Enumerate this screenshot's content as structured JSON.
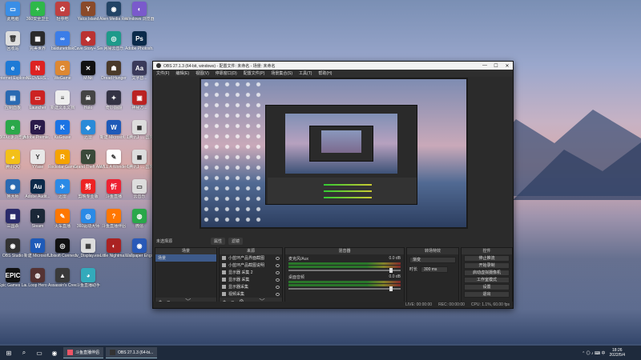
{
  "desktop": {
    "icons": [
      {
        "label": "此电脑",
        "color": "#3a8ee6",
        "glyph": "▭"
      },
      {
        "label": "360安全卫士",
        "color": "#2eb84a",
        "glyph": "+"
      },
      {
        "label": "轻亭吧",
        "color": "#c04040",
        "glyph": "✿"
      },
      {
        "label": "Yalcs Island",
        "color": "#8a4a2a",
        "glyph": "Y"
      },
      {
        "label": "Alien Media Recorder 4",
        "color": "#224466",
        "glyph": "◉"
      },
      {
        "label": "Windows 浏览器",
        "color": "#7a5acc",
        "glyph": "◐"
      },
      {
        "label": "回收站",
        "color": "#dddddd",
        "glyph": "🗑"
      },
      {
        "label": "完美世界",
        "color": "#2a2a2a",
        "glyph": "▦"
      },
      {
        "label": "baidunetdisk",
        "color": "#3b7de8",
        "glyph": "∞"
      },
      {
        "label": "Cave Story+ Secret Santa",
        "color": "#b33",
        "glyph": "◆"
      },
      {
        "label": "网易云音乐",
        "color": "#1e9a8a",
        "glyph": "◎"
      },
      {
        "label": "Adobe Photosh...",
        "color": "#0b2a4a",
        "glyph": "Ps"
      },
      {
        "label": "Internet Explorer",
        "color": "#1e7ad6",
        "glyph": "e"
      },
      {
        "label": "NEOVERS...",
        "color": "#d22",
        "glyph": "N"
      },
      {
        "label": "WeGame",
        "color": "#d83",
        "glyph": "G"
      },
      {
        "label": "MiNit",
        "color": "#111",
        "glyph": "✕"
      },
      {
        "label": "Dread Hunger",
        "color": "#4a3a2a",
        "glyph": "☗"
      },
      {
        "label": "文字替...",
        "color": "#3a3a5a",
        "glyph": "Aa"
      },
      {
        "label": "控制面板",
        "color": "#2a6ab2",
        "glyph": "▤"
      },
      {
        "label": "Launcher",
        "color": "#c22",
        "glyph": "▭"
      },
      {
        "label": "新建文本文档",
        "color": "#eee",
        "glyph": "≡"
      },
      {
        "label": "Holo",
        "color": "#444",
        "glyph": "☠"
      },
      {
        "label": "奇妙翻翻",
        "color": "#334",
        "glyph": "✦"
      },
      {
        "label": "神秘方...",
        "color": "#b22",
        "glyph": "▣"
      },
      {
        "label": "360极速浏览器",
        "color": "#2ba84a",
        "glyph": "e"
      },
      {
        "label": "Adobe Premie...",
        "color": "#2a1a4a",
        "glyph": "Pr"
      },
      {
        "label": "KuGouse",
        "color": "#1b74e4",
        "glyph": "K"
      },
      {
        "label": "迅雷",
        "color": "#2a8ad8",
        "glyph": "◆"
      },
      {
        "label": "新建 Microsof...",
        "color": "#1e5ab8",
        "glyph": "W"
      },
      {
        "label": "【腾讯】... 国外域名",
        "color": "#ddd",
        "glyph": "◼"
      },
      {
        "label": "腾讯QQ",
        "color": "#f3c018",
        "glyph": "◕"
      },
      {
        "label": "YYase",
        "color": "#e8e8e8",
        "glyph": "Y"
      },
      {
        "label": "Rockstar Games...",
        "color": "#f5a300",
        "glyph": "R"
      },
      {
        "label": "Grand Theft Auto V",
        "color": "#3a4a3a",
        "glyph": "V"
      },
      {
        "label": "WILL A Wonderf...",
        "color": "#fff",
        "glyph": "✎"
      },
      {
        "label": "【腾讯】... 国外域名",
        "color": "#ddd",
        "glyph": "◼"
      },
      {
        "label": "鲁大师",
        "color": "#2a6ab2",
        "glyph": "◉"
      },
      {
        "label": "Adobe Audit...",
        "color": "#0b2a4a",
        "glyph": "Au"
      },
      {
        "label": "迅雷",
        "color": "#2a8ae6",
        "glyph": "✈"
      },
      {
        "label": "剪映专业版",
        "color": "#e22",
        "glyph": "剪"
      },
      {
        "label": "斗鱼直播",
        "color": "#e23",
        "glyph": "忻"
      },
      {
        "label": "云音乐",
        "color": "#ddd",
        "glyph": "▭"
      },
      {
        "label": "三国杀",
        "color": "#2a2a6a",
        "glyph": "▩"
      },
      {
        "label": "Steam",
        "color": "#1b2838",
        "glyph": "◑"
      },
      {
        "label": "火车直播",
        "color": "#f70",
        "glyph": "✎"
      },
      {
        "label": "360驱动大师",
        "color": "#2a8ae6",
        "glyph": "◎"
      },
      {
        "label": "斗鱼直播伴侣",
        "color": "#f70",
        "glyph": "?"
      },
      {
        "label": "微信",
        "color": "#2aa84a",
        "glyph": "◍"
      },
      {
        "label": "OBS Studio",
        "color": "#333",
        "glyph": "◉"
      },
      {
        "label": "新建 Microsof...",
        "color": "#1e5ab8",
        "glyph": "W"
      },
      {
        "label": "Ubisoft Connect",
        "color": "#111",
        "glyph": "◎"
      },
      {
        "label": "Iv_Display.exe",
        "color": "#ddd",
        "glyph": "▦"
      },
      {
        "label": "Little Nightma...",
        "color": "#a22",
        "glyph": "◐"
      },
      {
        "label": "Wallpaper Engine...",
        "color": "#2a5ab8",
        "glyph": "◉"
      },
      {
        "label": "Epic Games Launcher",
        "color": "#111",
        "glyph": "EPIC"
      },
      {
        "label": "Loop Hero",
        "color": "#533",
        "glyph": "◍"
      },
      {
        "label": "Assassin's Creed O...",
        "color": "#3a3a3a",
        "glyph": "▲"
      },
      {
        "label": "斗鱼直播助手",
        "color": "#3ab",
        "glyph": "◕"
      }
    ]
  },
  "obs": {
    "title": "OBS 27.1.3 (64-bit, windows) - 配置文件: 未命名 - 场景: 未命名",
    "menu": [
      "文件(F)",
      "编辑(E)",
      "视图(V)",
      "停靠窗口(D)",
      "配置文件(P)",
      "场景集合(S)",
      "工具(T)",
      "帮助(H)"
    ],
    "no_source_label": "未选择源",
    "props_label": "属性",
    "filters_label": "滤镜",
    "docks": {
      "scenes": {
        "title": "场景",
        "items": [
          "场景"
        ]
      },
      "sources": {
        "title": "来源",
        "items": [
          "小蓝环产品界面截图",
          "小蓝环产品截图说明",
          "显示器 采集 2",
          "显示器 采集",
          "显示器采集",
          "视频采集",
          "图像"
        ]
      },
      "mixer": {
        "title": "混音器",
        "items": [
          {
            "name": "麦克风/Aux",
            "db": "0.0 dB"
          },
          {
            "name": "桌面音频",
            "db": "0.0 dB"
          }
        ]
      },
      "transitions": {
        "title": "转场特效",
        "type": "渐变",
        "duration_label": "时长",
        "duration": "300 ms"
      },
      "controls": {
        "title": "控件",
        "buttons": [
          "停止推流",
          "开始录制",
          "启动虚拟摄像机",
          "工作室模式",
          "设置",
          "退出"
        ]
      }
    },
    "status": {
      "live": "LIVE: 00:00:00",
      "rec": "REC: 00:00:00",
      "cpu": "CPU: 1.1%, 60.00 fps"
    }
  },
  "taskbar": {
    "apps": [
      {
        "label": "斗鱼直播伴侣",
        "color": "#e56"
      },
      {
        "label": "OBS 27.1.3 (64-bi...",
        "color": "#333"
      }
    ],
    "time": "18:26",
    "date": "2022/5/4"
  }
}
